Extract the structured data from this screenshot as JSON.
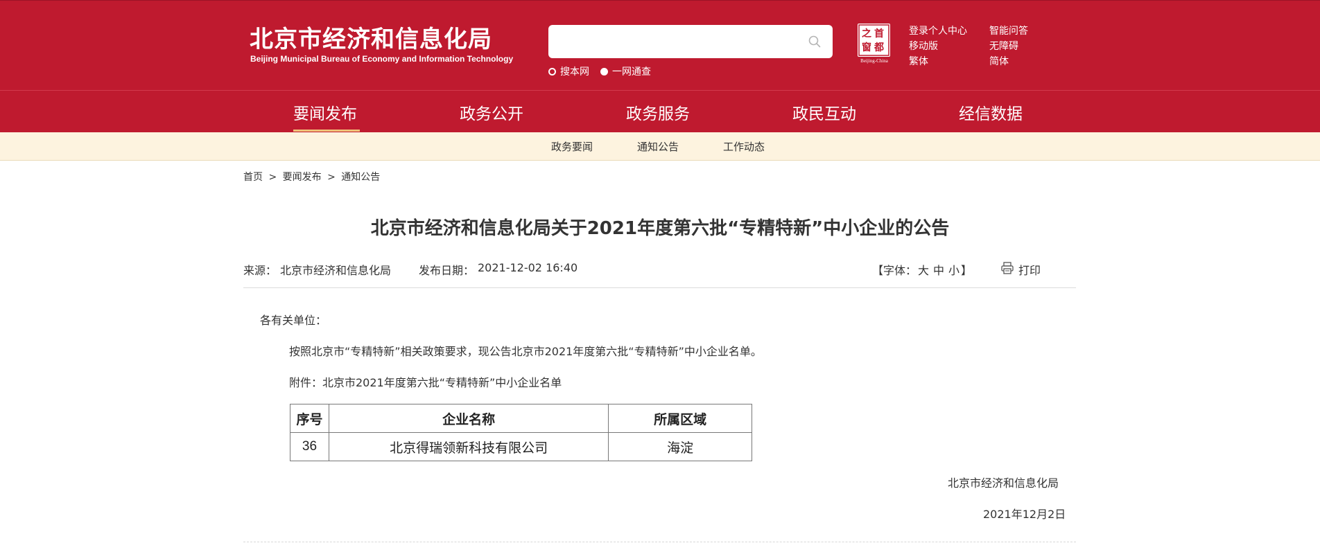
{
  "header": {
    "logo_cn": "北京市经济和信息化局",
    "logo_en": "Beijing Municipal Bureau of Economy and Information Technology",
    "search": {
      "value": "",
      "placeholder": ""
    },
    "radios": [
      {
        "label": "搜本网",
        "selected": false
      },
      {
        "label": "一网通查",
        "selected": true
      }
    ],
    "capital_logo": {
      "chars": [
        "之",
        "首",
        "窗",
        "都"
      ],
      "en": "Beijing-China"
    },
    "links": {
      "login": "登录个人中心",
      "ai_qa": "智能问答",
      "mobile": "移动版",
      "accessible": "无障碍",
      "traditional": "繁体",
      "simplified": "简体"
    },
    "colors": {
      "brand_red": "#bf1a2f",
      "subnav_bg": "#fdf3df",
      "active_underline": "#f0c27a"
    }
  },
  "nav": {
    "items": [
      "要闻发布",
      "政务公开",
      "政务服务",
      "政民互动",
      "经信数据"
    ],
    "active": "要闻发布"
  },
  "subnav": {
    "items": [
      "政务要闻",
      "通知公告",
      "工作动态"
    ]
  },
  "breadcrumb": {
    "items": [
      "首页",
      ">",
      "要闻发布",
      ">",
      "通知公告"
    ]
  },
  "article": {
    "title": "北京市经济和信息化局关于2021年度第六批“专精特新”中小企业的公告",
    "source_label": "来源：",
    "source": "北京市经济和信息化局",
    "date_label": "发布日期：",
    "date": "2021-12-02 16:40",
    "font_label_open": "【字体：",
    "font_sizes": [
      "大",
      "中",
      "小"
    ],
    "font_label_close": "】",
    "print_label": "打印",
    "salutation": "各有关单位：",
    "paragraph": "按照北京市“专精特新”相关政策要求，现公告北京市2021年度第六批“专精特新”中小企业名单。",
    "attachment": "附件：北京市2021年度第六批“专精特新”中小企业名单",
    "table": {
      "headers": [
        "序号",
        "企业名称",
        "所属区域"
      ],
      "rows": [
        [
          "36",
          "北京得瑞领新科技有限公司",
          "海淀"
        ]
      ]
    },
    "signature": "北京市经济和信息化局",
    "sign_date": "2021年12月2日"
  }
}
